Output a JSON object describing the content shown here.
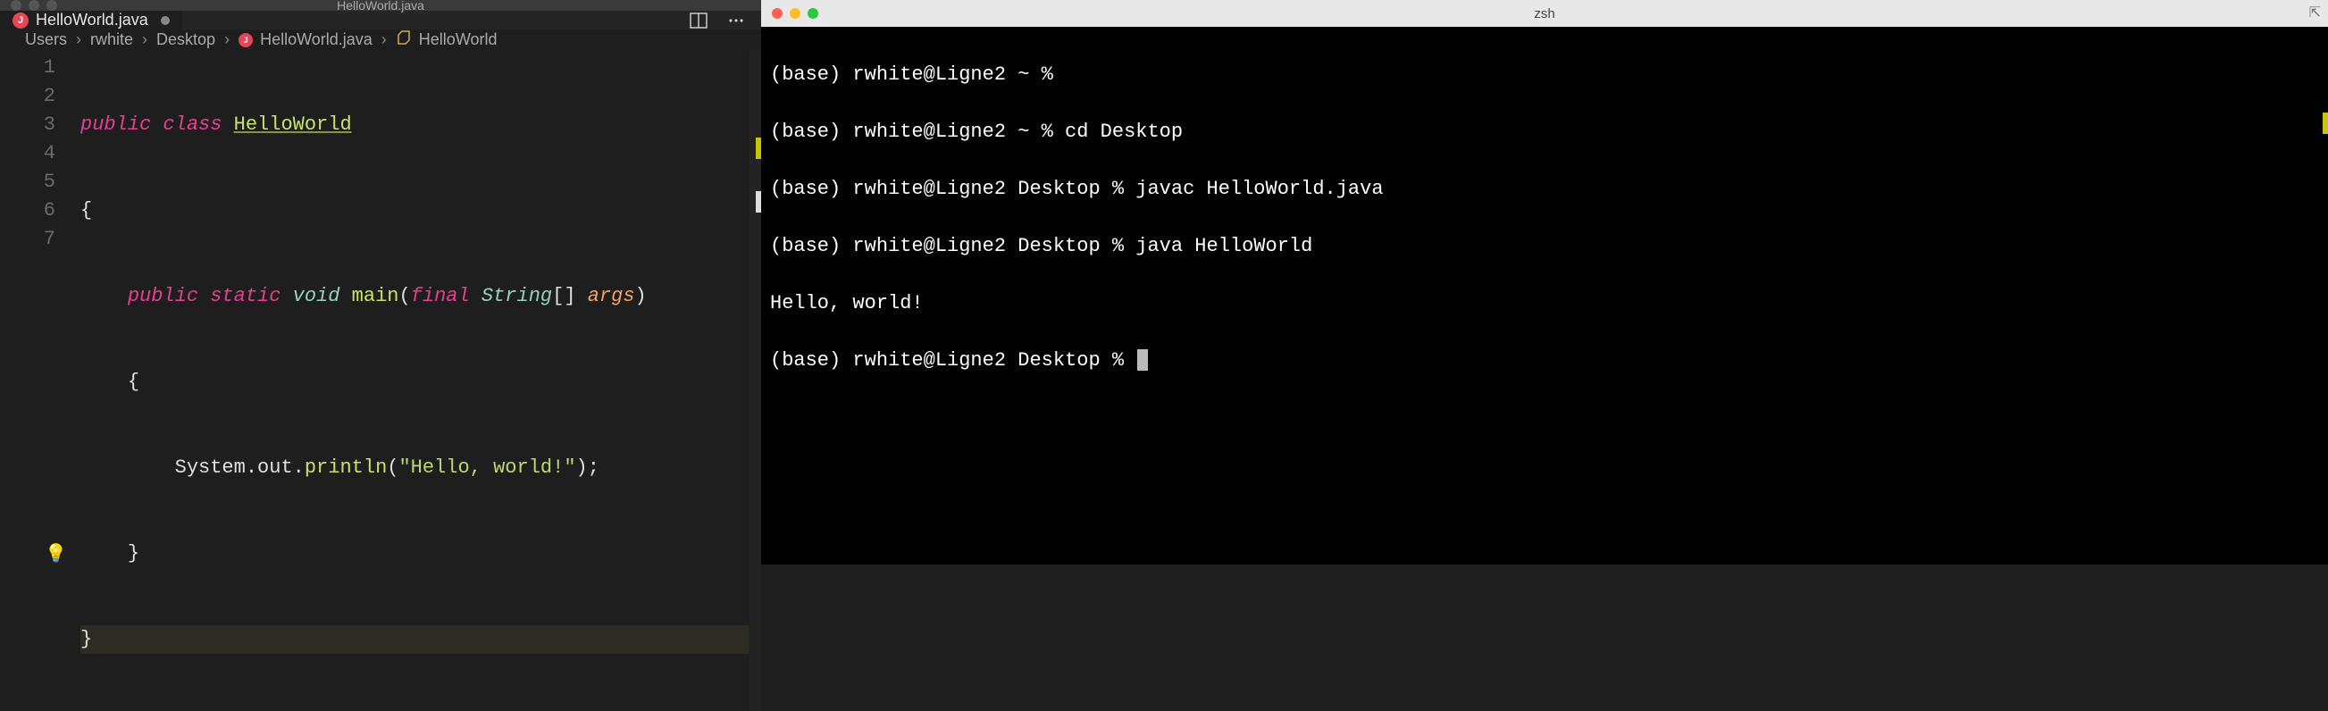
{
  "editor": {
    "window_title": "HelloWorld.java",
    "tab": {
      "filename": "HelloWorld.java",
      "icon_letter": "J",
      "dirty": true
    },
    "breadcrumb": {
      "seg1": "Users",
      "seg2": "rwhite",
      "seg3": "Desktop",
      "seg4": "HelloWorld.java",
      "seg4_icon": "J",
      "seg5": "HelloWorld"
    },
    "line_numbers": [
      "1",
      "2",
      "3",
      "4",
      "5",
      "6",
      "7"
    ],
    "code": {
      "l1": {
        "kw1": "public",
        "kw2": "class",
        "cls": "HelloWorld"
      },
      "l2": {
        "brace": "{"
      },
      "l3": {
        "kw1": "public",
        "kw2": "static",
        "ret": "void",
        "fn": "main",
        "lp": "(",
        "final": "final",
        "type": "String",
        "arr": "[]",
        "param": "args",
        "rp": ")"
      },
      "l4": {
        "brace": "{"
      },
      "l5": {
        "obj": "System.out.",
        "call": "println",
        "lp": "(",
        "str": "\"Hello, world!\"",
        "rp": ")",
        "semi": ";"
      },
      "l6": {
        "brace": "}"
      },
      "l7": {
        "brace": "}"
      }
    }
  },
  "terminal": {
    "window_title": "zsh",
    "proxy_icon": "⇱",
    "lines": {
      "l1_prompt": "(base) rwhite@Ligne2 ~ %",
      "l1_cmd": "",
      "l2_prompt": "(base) rwhite@Ligne2 ~ %",
      "l2_cmd": " cd Desktop",
      "l3_prompt": "(base) rwhite@Ligne2 Desktop %",
      "l3_cmd": " javac HelloWorld.java",
      "l4_prompt": "(base) rwhite@Ligne2 Desktop %",
      "l4_cmd": " java HelloWorld",
      "l5_out": "Hello, world!",
      "l6_prompt": "(base) rwhite@Ligne2 Desktop % "
    }
  }
}
